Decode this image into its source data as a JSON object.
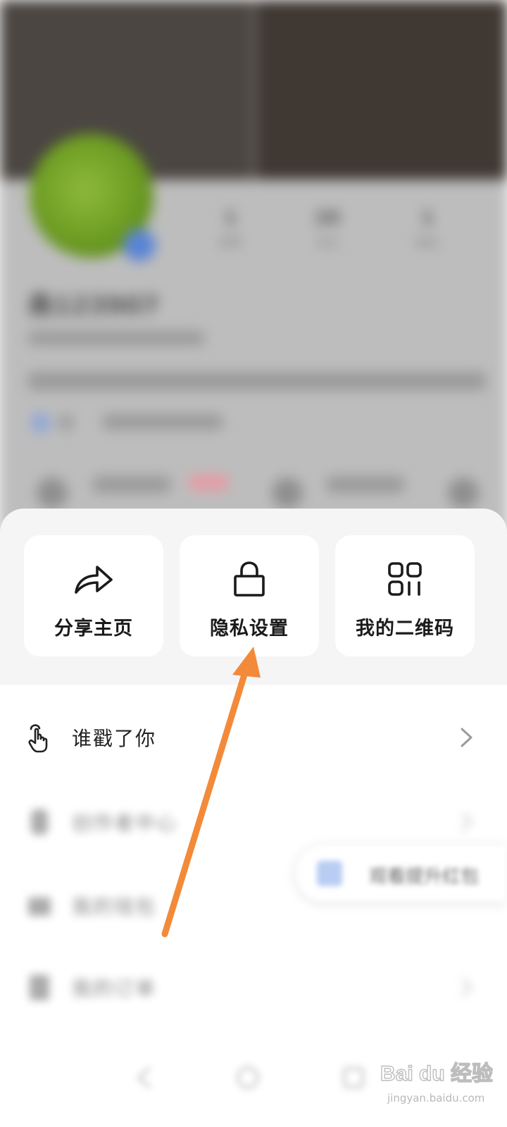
{
  "background_profile": {
    "nickname": "桑123907",
    "stats": [
      {
        "value": "1",
        "label": "获赞"
      },
      {
        "value": "20",
        "label": "关注"
      },
      {
        "value": "1",
        "label": "粉丝"
      }
    ]
  },
  "quick_actions": [
    {
      "label": "分享主页",
      "icon": "share-icon"
    },
    {
      "label": "隐私设置",
      "icon": "lock-icon"
    },
    {
      "label": "我的二维码",
      "icon": "qr-code-icon"
    }
  ],
  "menu": [
    {
      "label": "谁戳了你",
      "icon": "tap-hand-icon",
      "blurred": false
    },
    {
      "label": "创作者中心",
      "icon": "creator-icon",
      "blurred": true
    },
    {
      "label": "我的钱包",
      "icon": "wallet-icon",
      "blurred": true
    },
    {
      "label": "我的订单",
      "icon": "order-icon",
      "blurred": true
    }
  ],
  "floating_pill": {
    "label": "观看提升红包"
  },
  "annotation": {
    "color": "#f28a3a"
  },
  "watermark": {
    "brand": "Bai du 经验",
    "url": "jingyan.baidu.com"
  }
}
